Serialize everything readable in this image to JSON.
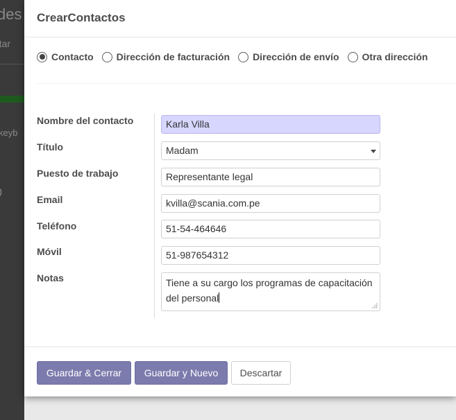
{
  "background": {
    "title_fragment": "des",
    "link_fragment": "rtar",
    "kbd_fragment": "keyb",
    "num_fragment": "0"
  },
  "modal": {
    "title": "CrearContactos",
    "address_types": [
      {
        "label": "Contacto",
        "checked": true
      },
      {
        "label": "Dirección de facturación",
        "checked": false
      },
      {
        "label": "Dirección de envío",
        "checked": false
      },
      {
        "label": "Otra dirección",
        "checked": false
      }
    ],
    "fields": {
      "name": {
        "label": "Nombre del contacto",
        "value": "Karla Villa"
      },
      "title": {
        "label": "Título",
        "value": "Madam"
      },
      "job": {
        "label": "Puesto de trabajo",
        "value": "Representante legal"
      },
      "email": {
        "label": "Email",
        "value": "kvilla@scania.com.pe"
      },
      "phone": {
        "label": "Teléfono",
        "value": "51-54-464646"
      },
      "mobile": {
        "label": "Móvil",
        "value": "51-987654312"
      },
      "notes": {
        "label": "Notas",
        "value": "Tiene a su cargo los programas de capacitación del personal"
      }
    },
    "buttons": {
      "save_close": "Guardar & Cerrar",
      "save_new": "Guardar y Nuevo",
      "discard": "Descartar"
    }
  },
  "colors": {
    "primary": "#7c7bad",
    "focused_input": "#d7d6ff"
  }
}
